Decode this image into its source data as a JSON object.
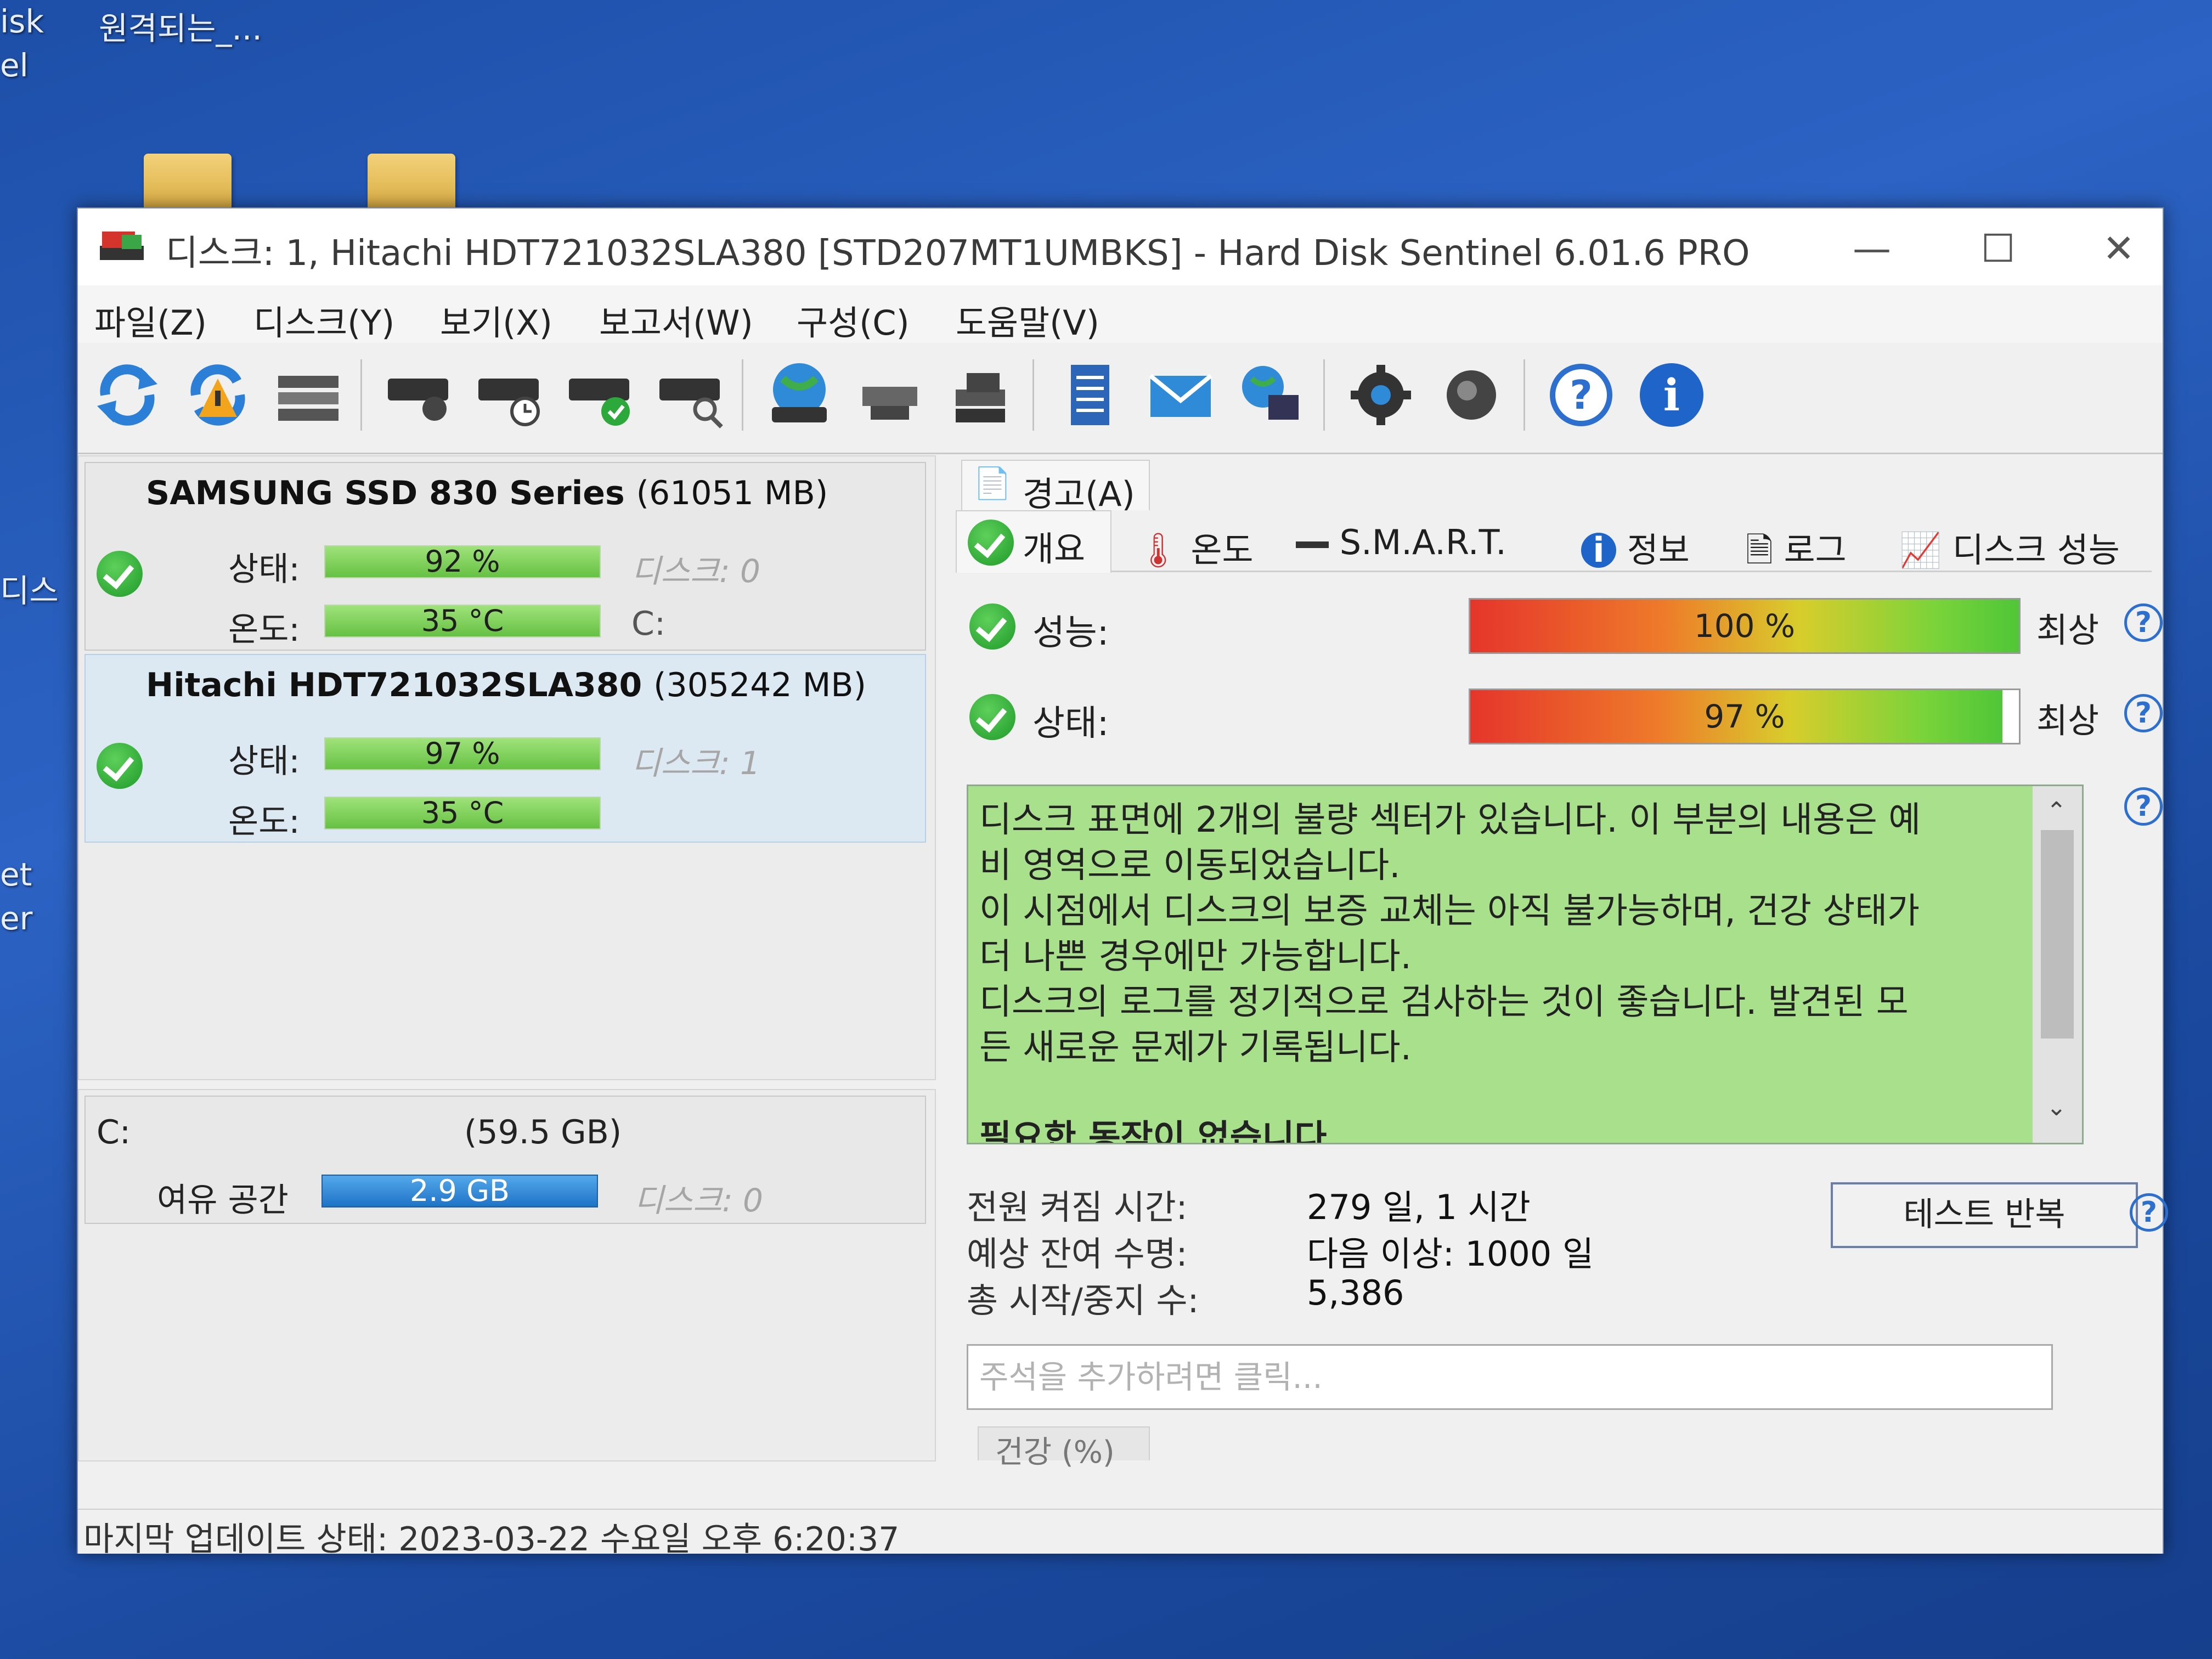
{
  "desktop": {
    "icon_labels_left": [
      "isk",
      "el",
      "디스",
      "et",
      "er"
    ],
    "top_label": "원격되는_..."
  },
  "window": {
    "title": "디스크: 1, Hitachi HDT721032SLA380 [STD207MT1UMBKS]  -  Hard Disk Sentinel 6.01.6 PRO"
  },
  "menu": [
    "파일(Z)",
    "디스크(Y)",
    "보기(X)",
    "보고서(W)",
    "구성(C)",
    "도움말(V)"
  ],
  "toolbar": {
    "icons": [
      "refresh-icon",
      "refresh-warning-icon",
      "disk-list-icon",
      "disk-icon",
      "disk-clock-icon",
      "disk-check-icon",
      "disk-search-icon",
      "globe-disk-icon",
      "network-icon",
      "hdd-stack-icon",
      "report-icon",
      "email-icon",
      "network-globe-icon",
      "gear-icon",
      "speaker-icon",
      "help-icon",
      "info-icon"
    ]
  },
  "disks": [
    {
      "name": "SAMSUNG SSD 830 Series",
      "size": "(61051 MB)",
      "status_label": "상태:",
      "status_value": "92 %",
      "status_pct": 92,
      "temp_label": "온도:",
      "temp_value": "35 °C",
      "disk_ref": "디스크: 0",
      "volume": "C:"
    },
    {
      "name": "Hitachi HDT721032SLA380",
      "size": "(305242 MB)",
      "status_label": "상태:",
      "status_value": "97 %",
      "status_pct": 97,
      "temp_label": "온도:",
      "temp_value": "35 °C",
      "disk_ref": "디스크: 1"
    }
  ],
  "volume": {
    "name": "C:",
    "size": "(59.5 GB)",
    "free_label": "여유 공간",
    "free_value": "2.9 GB",
    "disk_ref": "디스크: 0"
  },
  "tabs": {
    "alert": "경고(A)",
    "items": [
      "개요",
      "온도",
      "S.M.A.R.T.",
      "정보",
      "로그",
      "디스크 성능"
    ]
  },
  "overview": {
    "performance_label": "성능:",
    "performance_value": "100 %",
    "performance_pct": 100,
    "performance_rating": "최상",
    "health_label": "상태:",
    "health_value": "97 %",
    "health_pct": 97,
    "health_rating": "최상",
    "message_lines": [
      "디스크 표면에 2개의 불량 섹터가 있습니다. 이 부분의 내용은 예",
      "비 영역으로 이동되었습니다.",
      "이 시점에서 디스크의 보증 교체는 아직 불가능하며, 건강 상태가",
      "더 나쁜 경우에만 가능합니다.",
      "디스크의 로그를 정기적으로 검사하는 것이 좋습니다. 발견된 모",
      "든 새로운 문제가 기록됩니다.",
      "",
      "필요한 동작이 없습니다"
    ],
    "power_on_label": "전원 켜짐 시간:",
    "power_on_value": "279 일, 1 시간",
    "lifetime_label": "예상 잔여 수명:",
    "lifetime_value": "다음 이상: 1000 일",
    "startstop_label": "총 시작/중지 수:",
    "startstop_value": "5,386",
    "repeat_test_label": "테스트 반복",
    "note_placeholder": "주석을 추가하려면 클릭...",
    "health_chart_label": "건강 (%)"
  },
  "status_bar": "마지막 업데이트 상태: 2023-03-22 수요일 오후 6:20:37"
}
